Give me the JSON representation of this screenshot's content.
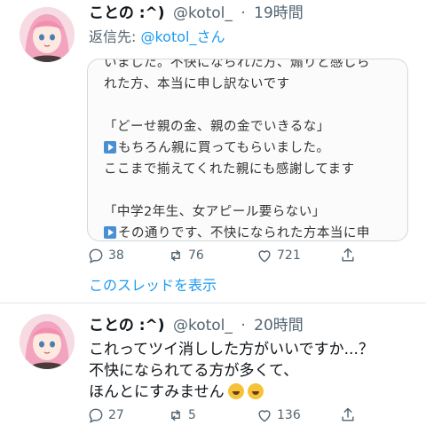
{
  "tweets": [
    {
      "author_name": "ことの :^)",
      "handle": "@kotol_",
      "separator": "·",
      "time": "19時間",
      "reply_prefix": "返信先: ",
      "reply_handle": "@kotol_さん",
      "image_lines": [
        "いました。不快になられた方、煽りと感じら",
        "れた方、本当に申し訳ないです",
        "",
        "「どーせ親の金、親の金でいきるな」",
        "もちろん親に買ってもらいました。",
        "ここまで揃えてくれた親にも感謝してます",
        "",
        "「中学2年生、女アピール要らない」",
        "その通りです、不快になられた方本当に申"
      ],
      "reply_count": "38",
      "retweet_count": "76",
      "like_count": "721",
      "thread_link": "このスレッドを表示"
    },
    {
      "author_name": "ことの :^)",
      "handle": "@kotol_",
      "separator": "·",
      "time": "20時間",
      "body_lines": [
        "これってツイ消しした方がいいですか...？",
        "不快になられてる方が多くて、",
        "ほんとにすみません"
      ],
      "reply_count": "27",
      "retweet_count": "5",
      "like_count": "136"
    }
  ]
}
